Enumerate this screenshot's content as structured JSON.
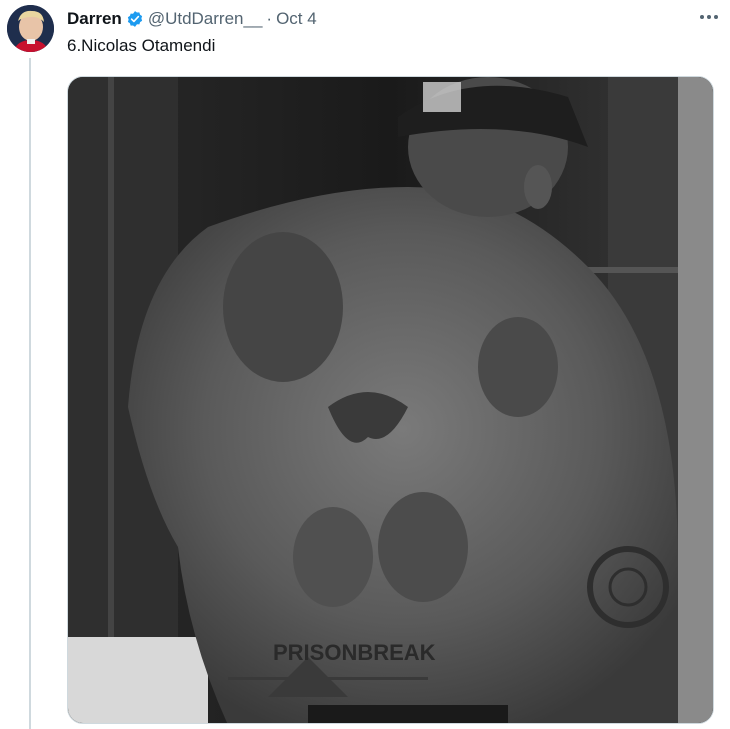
{
  "tweet": {
    "author_name": "Darren",
    "handle": "@UtdDarren__",
    "separator": "·",
    "date": "Oct 4",
    "text": "6.Nicolas Otamendi",
    "more_icon": "more-horizontal-icon",
    "verified_icon": "verified-badge-icon",
    "verified_color": "#1d9bf0"
  },
  "media": {
    "tattoo_text": "PRISONBREAK"
  }
}
